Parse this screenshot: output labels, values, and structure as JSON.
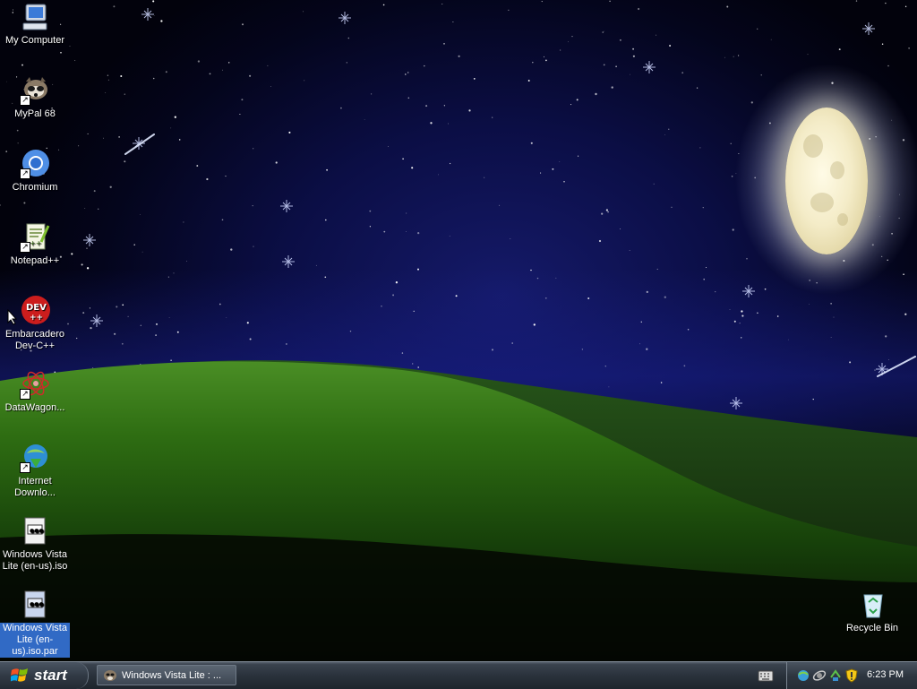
{
  "desktop": {
    "icons": [
      {
        "label": "My Computer",
        "icon": "my-computer-icon",
        "shortcut": false
      },
      {
        "label": "MyPal 68",
        "icon": "raccoon-browser-icon",
        "shortcut": true
      },
      {
        "label": "Chromium",
        "icon": "chromium-icon",
        "shortcut": true
      },
      {
        "label": "Notepad++",
        "icon": "notepad-plus-plus-icon",
        "shortcut": true
      },
      {
        "label": "Embarcadero Dev-C++",
        "icon": "dev-cpp-icon",
        "shortcut": false
      },
      {
        "label": "DataWagon...",
        "icon": "datawagon-icon",
        "shortcut": true
      },
      {
        "label": "Internet Downlo...",
        "icon": "internet-download-manager-icon",
        "shortcut": true
      },
      {
        "label": "Windows Vista Lite (en-us).iso",
        "icon": "iso-file-icon",
        "shortcut": false
      },
      {
        "label": "Windows Vista Lite (en-us).iso.par",
        "icon": "iso-file-icon",
        "shortcut": false,
        "selected": true
      }
    ],
    "recycle_bin": {
      "label": "Recycle Bin",
      "icon": "recycle-bin-icon"
    }
  },
  "taskbar": {
    "start_label": "start",
    "task_items": [
      {
        "label": "Windows Vista Lite : ...",
        "icon": "raccoon-browser-icon"
      }
    ],
    "tray_icons": [
      "network-icon",
      "satellite-icon",
      "sync-icon",
      "security-shield-icon"
    ],
    "clock": "6:23 PM"
  },
  "colors": {
    "selection": "#316ac5",
    "taskbar": "#2a323c",
    "sky": "#0b0e45",
    "grass": "#2e6d12"
  }
}
